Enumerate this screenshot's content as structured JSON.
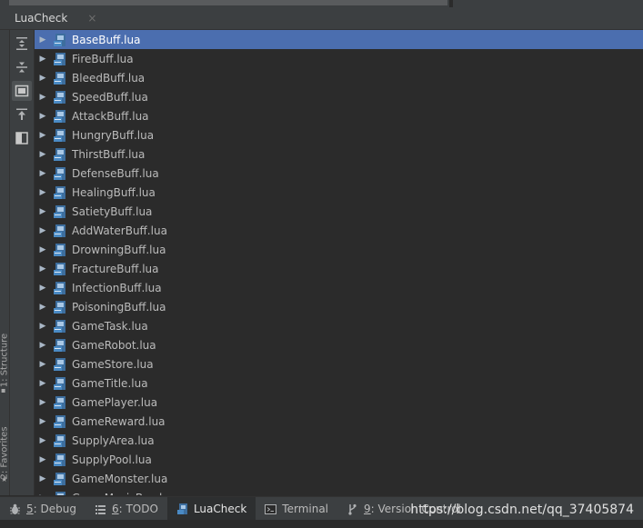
{
  "panel": {
    "title": "LuaCheck",
    "close_glyph": "×"
  },
  "side_tabs": {
    "structure": "1: Structure",
    "favorites": "2: Favorites"
  },
  "toolbar": [
    {
      "name": "expand-all-icon"
    },
    {
      "name": "collapse-all-icon"
    },
    {
      "name": "group-by-folder-icon",
      "active": true
    },
    {
      "name": "export-icon"
    },
    {
      "name": "toggle-panel-icon"
    }
  ],
  "tree": {
    "items": [
      "BaseBuff.lua",
      "FireBuff.lua",
      "BleedBuff.lua",
      "SpeedBuff.lua",
      "AttackBuff.lua",
      "HungryBuff.lua",
      "ThirstBuff.lua",
      "DefenseBuff.lua",
      "HealingBuff.lua",
      "SatietyBuff.lua",
      "AddWaterBuff.lua",
      "DrowningBuff.lua",
      "FractureBuff.lua",
      "InfectionBuff.lua",
      "PoisoningBuff.lua",
      "GameTask.lua",
      "GameRobot.lua",
      "GameStore.lua",
      "GameTitle.lua",
      "GamePlayer.lua",
      "GameReward.lua",
      "SupplyArea.lua",
      "SupplyPool.lua",
      "GameMonster.lua",
      "GameMusicBox.lua"
    ],
    "selected_index": 0,
    "expand_glyph": "▶"
  },
  "status_bar": {
    "tabs": [
      {
        "key": "5",
        "label": ": Debug",
        "icon": "bug-icon"
      },
      {
        "key": "6",
        "label": ": TODO",
        "icon": "todo-list-icon"
      },
      {
        "key": "",
        "label": "LuaCheck",
        "icon": "luacheck-icon",
        "active": true
      },
      {
        "key": "",
        "label": "Terminal",
        "icon": "terminal-icon"
      },
      {
        "key": "9",
        "label": ": Version Control",
        "icon": "version-control-icon"
      }
    ],
    "watermark": "https://blog.csdn.net/qq_37405874"
  },
  "colors": {
    "selection": "#4b6eaf",
    "background": "#2b2b2b",
    "chrome": "#3c3f41",
    "file_icon": "#4a8ac4"
  }
}
